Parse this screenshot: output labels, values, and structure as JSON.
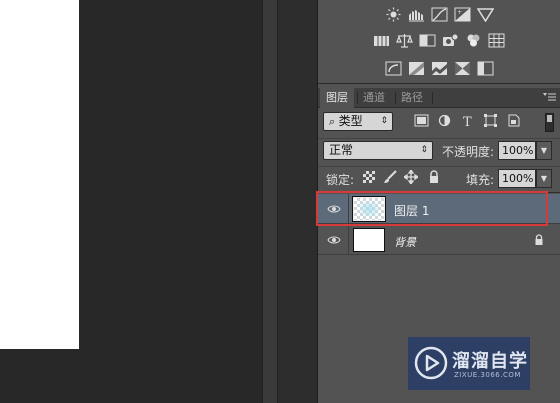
{
  "layers_panel": {
    "tabs": [
      {
        "label": "图层",
        "active": true
      },
      {
        "label": "通道",
        "active": false
      },
      {
        "label": "路径",
        "active": false
      }
    ],
    "filter": {
      "kind_label": "类型",
      "kind_arrow": "⇕"
    },
    "blend": {
      "mode": "正常",
      "mode_arrow": "⇕",
      "opacity_label": "不透明度:",
      "opacity_value": "100%"
    },
    "lock": {
      "label": "锁定:",
      "fill_label": "填充:",
      "fill_value": "100%"
    },
    "layers": [
      {
        "name": "图层 1",
        "selected": true,
        "visible": true
      },
      {
        "name": "背景",
        "selected": false,
        "visible": true,
        "locked": true
      }
    ]
  },
  "watermark": {
    "title": "溜溜自学",
    "url": "ZIXUE.3066.COM"
  },
  "colors": {
    "panel_bg": "#535353",
    "selection": "#5d6a7a",
    "highlight": "#d63a3a"
  }
}
